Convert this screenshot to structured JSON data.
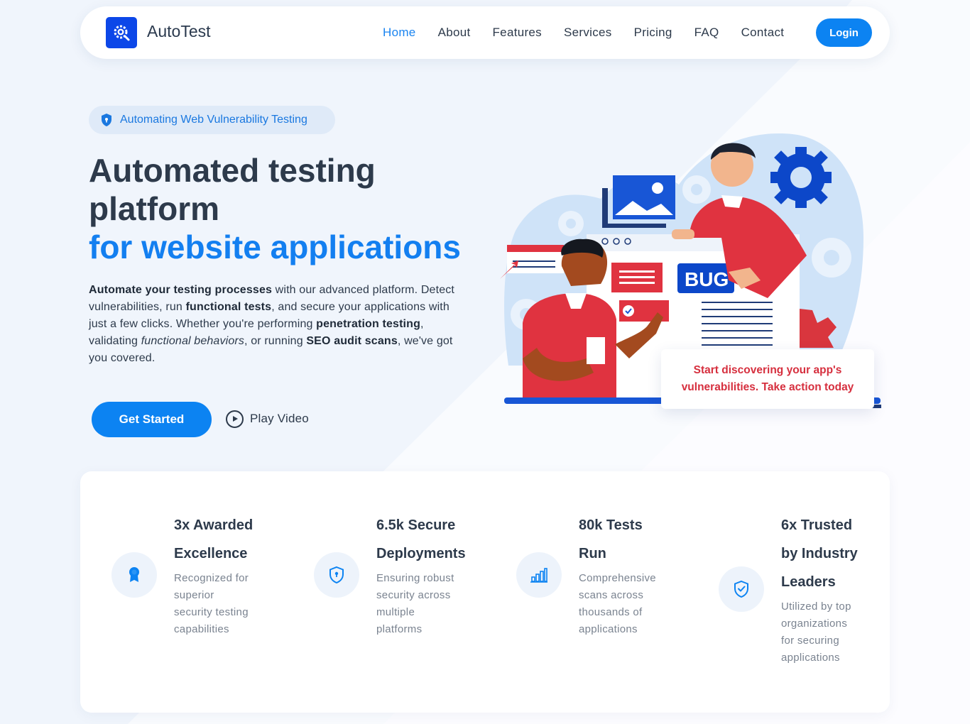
{
  "nav": {
    "brand": "AutoTest",
    "links": [
      "Home",
      "About",
      "Features",
      "Services",
      "Pricing",
      "FAQ",
      "Contact"
    ],
    "active": "Home",
    "login": "Login"
  },
  "hero": {
    "badge": "Automating Web Vulnerability Testing",
    "title_line1": "Automated testing",
    "title_line2": "platform",
    "title_line3": "for website applications",
    "desc": {
      "p1_b": "Automate your testing processes",
      "p1": " with our advanced platform. Detect vulnerabilities, run ",
      "p2_b": "functional tests",
      "p2": ", and secure your applications with just a few clicks. Whether you're performing ",
      "p3_b": "penetration testing",
      "p3": ", validating ",
      "p4_i": "functional behaviors",
      "p4": ", or running ",
      "p5_b": "SEO audit scans",
      "p5": ", we've got you covered."
    },
    "get_started": "Get Started",
    "play_video": "Play Video",
    "callout": "Start discovering your app's vulnerabilities. Take action today",
    "illustration_label": "BUG"
  },
  "stats": [
    {
      "icon": "award-icon",
      "title_l1": "3x Awarded",
      "title_l2": "Excellence",
      "title_l3": "",
      "desc": [
        "Recognized for",
        "superior",
        "security testing",
        "capabilities"
      ]
    },
    {
      "icon": "shield-icon",
      "title_l1": "6.5k Secure",
      "title_l2": "Deployments",
      "title_l3": "",
      "desc": [
        "Ensuring robust",
        "security across",
        "multiple",
        "platforms"
      ]
    },
    {
      "icon": "bar-chart-icon",
      "title_l1": "80k Tests",
      "title_l2": "Run",
      "title_l3": "",
      "desc": [
        "Comprehensive",
        "scans across",
        "thousands of",
        "applications"
      ]
    },
    {
      "icon": "shield-check-icon",
      "title_l1": "6x Trusted",
      "title_l2": "by Industry",
      "title_l3": "Leaders",
      "desc": [
        "Utilized by top",
        "organizations",
        "for securing",
        "applications"
      ]
    }
  ],
  "colors": {
    "primary": "#0c83f2",
    "accent_red": "#d62f3e",
    "text_dark": "#2d3a4b",
    "logo_blue": "#0c47e8"
  }
}
